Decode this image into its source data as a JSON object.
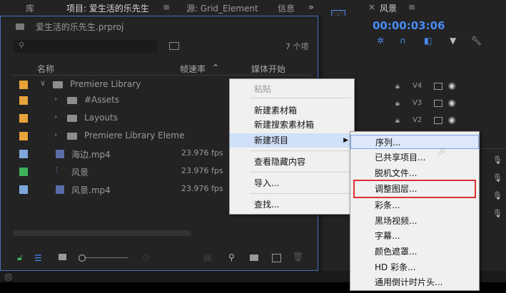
{
  "tabs": {
    "library": "库",
    "project": "项目: 爱生活的乐先生",
    "project_menu": "≡",
    "source": "源: Grid_Element",
    "info": "信息",
    "overflow": "»",
    "sequence_close": "×",
    "sequence": "风景",
    "sequence_menu": "≡"
  },
  "project": {
    "filename": "爱生活的乐先生.prproj",
    "item_count": "7 个项",
    "columns": {
      "name": "名称",
      "framerate": "帧速率",
      "media_start": "媒体开始"
    },
    "items": [
      {
        "label": "Premiere Library",
        "color": "#e8a33a",
        "indent": 0,
        "expand": "∨",
        "type": "folder",
        "fps": ""
      },
      {
        "label": "#Assets",
        "color": "#e8a33a",
        "indent": 1,
        "expand": "›",
        "type": "folder",
        "fps": ""
      },
      {
        "label": "Layouts",
        "color": "#e8a33a",
        "indent": 1,
        "expand": "›",
        "type": "folder",
        "fps": ""
      },
      {
        "label": "Premiere Library Eleme",
        "color": "#e8a33a",
        "indent": 1,
        "expand": "›",
        "type": "folder",
        "fps": ""
      },
      {
        "label": "海边.mp4",
        "color": "#7fa7dc",
        "indent": 1,
        "expand": "",
        "type": "clip",
        "fps": "23.976 fps"
      },
      {
        "label": "风景",
        "color": "#3eb25b",
        "indent": 1,
        "expand": "",
        "type": "sequence",
        "fps": "23.976 fps"
      },
      {
        "label": "风景.mp4",
        "color": "#7fa7dc",
        "indent": 1,
        "expand": "",
        "type": "clip",
        "fps": "23.976 fps"
      }
    ]
  },
  "timecode": "00:00:03:06",
  "tracks": [
    {
      "label": "V4"
    },
    {
      "label": "V3"
    },
    {
      "label": "V2"
    }
  ],
  "context_menu": {
    "items": [
      {
        "label": "粘贴",
        "disabled": true
      },
      {
        "label": "新建素材箱"
      },
      {
        "label": "新建搜索素材箱"
      },
      {
        "label": "新建项目",
        "submenu": true,
        "highlighted": true
      },
      {
        "label": "查看隐藏内容"
      },
      {
        "label": "导入..."
      },
      {
        "label": "查找..."
      }
    ]
  },
  "submenu": {
    "items": [
      {
        "label": "序列..."
      },
      {
        "label": "已共享项目..."
      },
      {
        "label": "脱机文件..."
      },
      {
        "label": "调整图层...",
        "boxed": true
      },
      {
        "label": "彩条..."
      },
      {
        "label": "黑场视频..."
      },
      {
        "label": "字幕..."
      },
      {
        "label": "颜色遮罩..."
      },
      {
        "label": "HD 彩条..."
      },
      {
        "label": "通用倒计时片头..."
      }
    ]
  },
  "colors": {
    "accent": "#4a8bf5",
    "timecode": "#4a8bf5",
    "highlight_box": "#e03030"
  },
  "watermark": "爱生活的乐先生"
}
